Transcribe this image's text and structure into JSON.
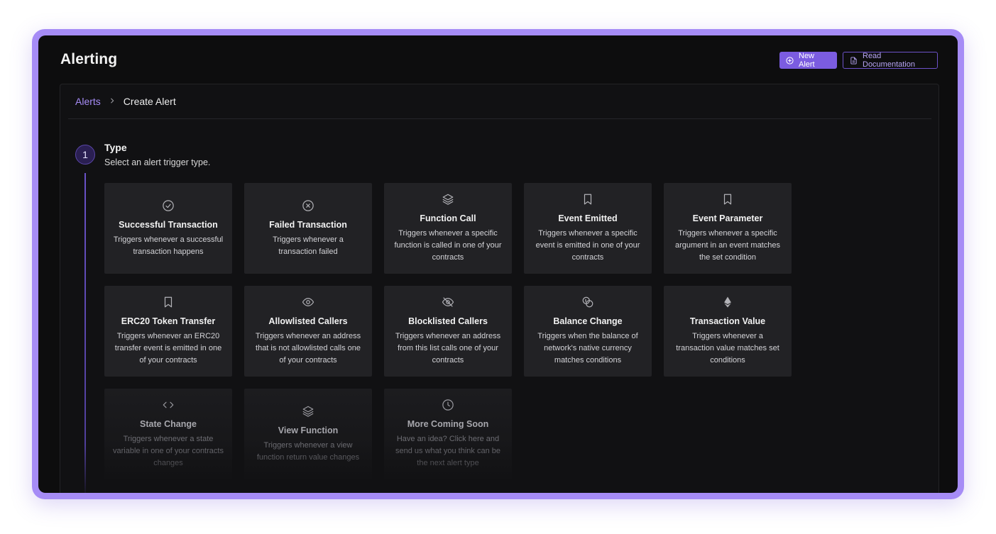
{
  "header": {
    "title": "Alerting",
    "new_alert_label": "New Alert",
    "read_docs_label": "Read Documentation"
  },
  "breadcrumb": {
    "parent": "Alerts",
    "current": "Create Alert"
  },
  "step": {
    "number": "1",
    "title": "Type",
    "subtitle": "Select an alert trigger type."
  },
  "cards": [
    {
      "title": "Successful Transaction",
      "desc": "Triggers whenever a successful transaction happens",
      "icon": "check-circle-icon"
    },
    {
      "title": "Failed Transaction",
      "desc": "Triggers whenever a transaction failed",
      "icon": "x-circle-icon"
    },
    {
      "title": "Function Call",
      "desc": "Triggers whenever a specific function is called in one of your contracts",
      "icon": "layers-icon"
    },
    {
      "title": "Event Emitted",
      "desc": "Triggers whenever a specific event is emitted in one of your contracts",
      "icon": "bookmark-icon"
    },
    {
      "title": "Event Parameter",
      "desc": "Triggers whenever a specific argument in an event matches the set condition",
      "icon": "bookmark-icon"
    },
    {
      "title": "ERC20 Token Transfer",
      "desc": "Triggers whenever an ERC20 transfer event is emitted in one of your contracts",
      "icon": "bookmark-icon"
    },
    {
      "title": "Allowlisted Callers",
      "desc": "Triggers whenever an address that is not allowlisted calls one of your contracts",
      "icon": "eye-icon"
    },
    {
      "title": "Blocklisted Callers",
      "desc": "Triggers whenever an address from this list calls one of your contracts",
      "icon": "eye-off-icon"
    },
    {
      "title": "Balance Change",
      "desc": "Triggers when the balance of network's native currency matches conditions",
      "icon": "coins-icon"
    },
    {
      "title": "Transaction Value",
      "desc": "Triggers whenever a transaction value matches set conditions",
      "icon": "ethereum-icon"
    },
    {
      "title": "State Change",
      "desc": "Triggers whenever a state variable in one of your contracts changes",
      "icon": "code-icon"
    },
    {
      "title": "View Function",
      "desc": "Triggers whenever a view function return value changes",
      "icon": "layers-icon"
    },
    {
      "title": "More Coming Soon",
      "desc": "Have an idea? Click here and send us what you think can be the next alert type",
      "icon": "clock-icon"
    }
  ],
  "colors": {
    "accent": "#7b5ce0",
    "accent_light": "#a68cf6",
    "background": "#0d0d0e",
    "card": "#222225"
  }
}
